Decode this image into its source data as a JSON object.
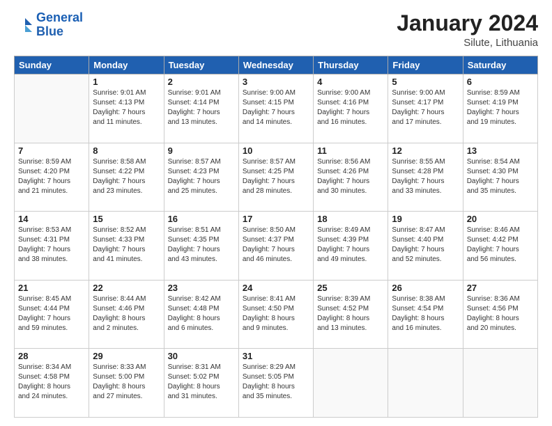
{
  "header": {
    "logo_line1": "General",
    "logo_line2": "Blue",
    "title": "January 2024",
    "subtitle": "Silute, Lithuania"
  },
  "days_of_week": [
    "Sunday",
    "Monday",
    "Tuesday",
    "Wednesday",
    "Thursday",
    "Friday",
    "Saturday"
  ],
  "weeks": [
    [
      {
        "num": "",
        "info": ""
      },
      {
        "num": "1",
        "info": "Sunrise: 9:01 AM\nSunset: 4:13 PM\nDaylight: 7 hours\nand 11 minutes."
      },
      {
        "num": "2",
        "info": "Sunrise: 9:01 AM\nSunset: 4:14 PM\nDaylight: 7 hours\nand 13 minutes."
      },
      {
        "num": "3",
        "info": "Sunrise: 9:00 AM\nSunset: 4:15 PM\nDaylight: 7 hours\nand 14 minutes."
      },
      {
        "num": "4",
        "info": "Sunrise: 9:00 AM\nSunset: 4:16 PM\nDaylight: 7 hours\nand 16 minutes."
      },
      {
        "num": "5",
        "info": "Sunrise: 9:00 AM\nSunset: 4:17 PM\nDaylight: 7 hours\nand 17 minutes."
      },
      {
        "num": "6",
        "info": "Sunrise: 8:59 AM\nSunset: 4:19 PM\nDaylight: 7 hours\nand 19 minutes."
      }
    ],
    [
      {
        "num": "7",
        "info": "Sunrise: 8:59 AM\nSunset: 4:20 PM\nDaylight: 7 hours\nand 21 minutes."
      },
      {
        "num": "8",
        "info": "Sunrise: 8:58 AM\nSunset: 4:22 PM\nDaylight: 7 hours\nand 23 minutes."
      },
      {
        "num": "9",
        "info": "Sunrise: 8:57 AM\nSunset: 4:23 PM\nDaylight: 7 hours\nand 25 minutes."
      },
      {
        "num": "10",
        "info": "Sunrise: 8:57 AM\nSunset: 4:25 PM\nDaylight: 7 hours\nand 28 minutes."
      },
      {
        "num": "11",
        "info": "Sunrise: 8:56 AM\nSunset: 4:26 PM\nDaylight: 7 hours\nand 30 minutes."
      },
      {
        "num": "12",
        "info": "Sunrise: 8:55 AM\nSunset: 4:28 PM\nDaylight: 7 hours\nand 33 minutes."
      },
      {
        "num": "13",
        "info": "Sunrise: 8:54 AM\nSunset: 4:30 PM\nDaylight: 7 hours\nand 35 minutes."
      }
    ],
    [
      {
        "num": "14",
        "info": "Sunrise: 8:53 AM\nSunset: 4:31 PM\nDaylight: 7 hours\nand 38 minutes."
      },
      {
        "num": "15",
        "info": "Sunrise: 8:52 AM\nSunset: 4:33 PM\nDaylight: 7 hours\nand 41 minutes."
      },
      {
        "num": "16",
        "info": "Sunrise: 8:51 AM\nSunset: 4:35 PM\nDaylight: 7 hours\nand 43 minutes."
      },
      {
        "num": "17",
        "info": "Sunrise: 8:50 AM\nSunset: 4:37 PM\nDaylight: 7 hours\nand 46 minutes."
      },
      {
        "num": "18",
        "info": "Sunrise: 8:49 AM\nSunset: 4:39 PM\nDaylight: 7 hours\nand 49 minutes."
      },
      {
        "num": "19",
        "info": "Sunrise: 8:47 AM\nSunset: 4:40 PM\nDaylight: 7 hours\nand 52 minutes."
      },
      {
        "num": "20",
        "info": "Sunrise: 8:46 AM\nSunset: 4:42 PM\nDaylight: 7 hours\nand 56 minutes."
      }
    ],
    [
      {
        "num": "21",
        "info": "Sunrise: 8:45 AM\nSunset: 4:44 PM\nDaylight: 7 hours\nand 59 minutes."
      },
      {
        "num": "22",
        "info": "Sunrise: 8:44 AM\nSunset: 4:46 PM\nDaylight: 8 hours\nand 2 minutes."
      },
      {
        "num": "23",
        "info": "Sunrise: 8:42 AM\nSunset: 4:48 PM\nDaylight: 8 hours\nand 6 minutes."
      },
      {
        "num": "24",
        "info": "Sunrise: 8:41 AM\nSunset: 4:50 PM\nDaylight: 8 hours\nand 9 minutes."
      },
      {
        "num": "25",
        "info": "Sunrise: 8:39 AM\nSunset: 4:52 PM\nDaylight: 8 hours\nand 13 minutes."
      },
      {
        "num": "26",
        "info": "Sunrise: 8:38 AM\nSunset: 4:54 PM\nDaylight: 8 hours\nand 16 minutes."
      },
      {
        "num": "27",
        "info": "Sunrise: 8:36 AM\nSunset: 4:56 PM\nDaylight: 8 hours\nand 20 minutes."
      }
    ],
    [
      {
        "num": "28",
        "info": "Sunrise: 8:34 AM\nSunset: 4:58 PM\nDaylight: 8 hours\nand 24 minutes."
      },
      {
        "num": "29",
        "info": "Sunrise: 8:33 AM\nSunset: 5:00 PM\nDaylight: 8 hours\nand 27 minutes."
      },
      {
        "num": "30",
        "info": "Sunrise: 8:31 AM\nSunset: 5:02 PM\nDaylight: 8 hours\nand 31 minutes."
      },
      {
        "num": "31",
        "info": "Sunrise: 8:29 AM\nSunset: 5:05 PM\nDaylight: 8 hours\nand 35 minutes."
      },
      {
        "num": "",
        "info": ""
      },
      {
        "num": "",
        "info": ""
      },
      {
        "num": "",
        "info": ""
      }
    ]
  ]
}
